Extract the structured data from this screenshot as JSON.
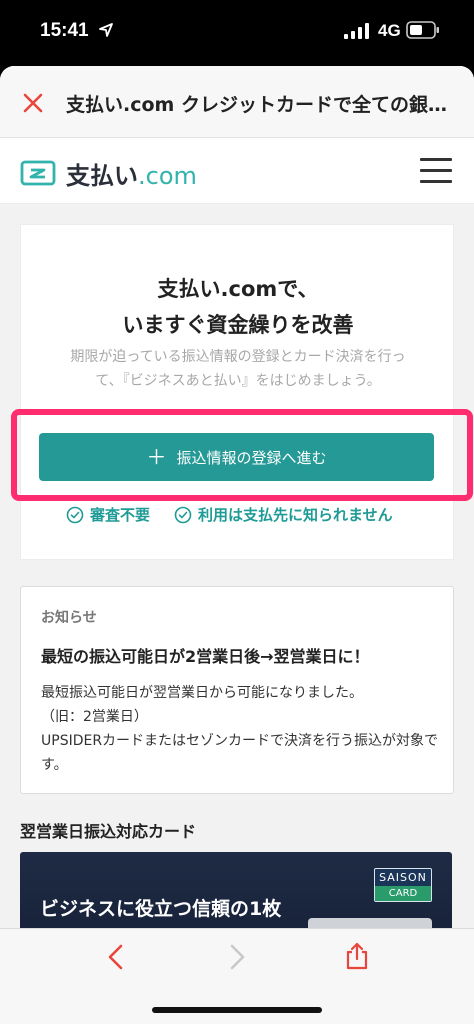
{
  "status_bar": {
    "time": "15:41",
    "network": "4G",
    "icons": [
      "location-arrow-icon",
      "signal-bars-icon",
      "battery-icon"
    ]
  },
  "browser": {
    "page_title": "支払い.com クレジットカードで全ての銀…",
    "close_icon": "close-icon",
    "accent_color": "#e8453c"
  },
  "site": {
    "logo_main": "支払い",
    "logo_suffix": ".com",
    "menu_icon": "hamburger-menu-icon",
    "brand_color": "#32b3ab"
  },
  "hero": {
    "title_line1": "支払い.comで、",
    "title_line2": "いますぐ資金繰りを改善",
    "description": "期限が迫っている振込情報の登録とカード決済を行って、『ビジネスあと払い』をはじめましょう。",
    "cta_icon": "＋",
    "cta_label": "振込情報の登録へ進む",
    "cta_color": "#259996",
    "highlight_color": "#ff2d6f",
    "checks": [
      "審査不要",
      "利用は支払先に知られません"
    ]
  },
  "notice": {
    "label": "お知らせ",
    "title": "最短の振込可能日が2営業日後→翌営業日に！",
    "body_line1": "最短振込可能日が翌営業日から可能になりました。",
    "body_line2": "（旧：2営業日）",
    "body_line3": "UPSIDERカードまたはセゾンカードで決済を行う振込が対象です。"
  },
  "cards_section": {
    "title": "翌営業日振込対応カード",
    "promo_text": "ビジネスに役立つ信頼の1枚",
    "saison_top": "SAISON",
    "saison_bottom": "CARD"
  },
  "toolbar": {
    "icons": [
      "back-chevron-icon",
      "forward-chevron-icon",
      "share-icon"
    ],
    "accent_color": "#e8453c"
  }
}
